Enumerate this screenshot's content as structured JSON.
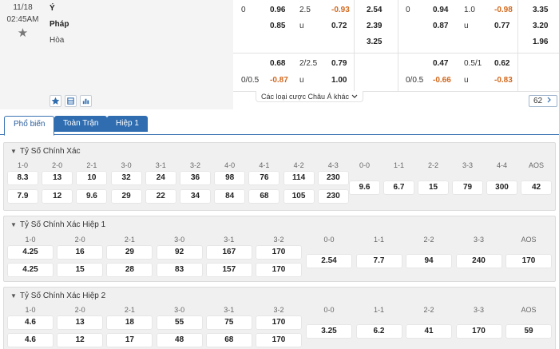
{
  "match": {
    "date": "11/18",
    "time": "02:45AM",
    "home": "Ý",
    "away": "Pháp",
    "draw": "Hòa",
    "more_bets_label": "Các loại cược Châu Á khác",
    "bet_count": "62",
    "odds": {
      "full": {
        "hdp_line": "0",
        "hdp_home": "0.96",
        "hdp_away": "0.85",
        "ou_line": "2.5",
        "ou_over": "-0.93",
        "ou_under_label": "u",
        "ou_under": "0.72",
        "x12_home": "2.54",
        "x12_away": "2.39",
        "x12_draw": "3.25"
      },
      "full_alt": {
        "hdp_line": "0/0.5",
        "hdp_home": "0.68",
        "hdp_away": "-0.87",
        "ou_line": "2/2.5",
        "ou_over": "0.79",
        "ou_under_label": "u",
        "ou_under": "1.00"
      },
      "half": {
        "hdp_line": "0",
        "hdp_home": "0.94",
        "hdp_away": "0.87",
        "ou_line": "1.0",
        "ou_over": "-0.98",
        "ou_under_label": "u",
        "ou_under": "0.77",
        "x12_home": "3.35",
        "x12_away": "3.20",
        "x12_draw": "1.96"
      },
      "half_alt": {
        "hdp_line": "0/0.5",
        "hdp_home": "0.47",
        "hdp_away": "-0.66",
        "ou_line": "0.5/1",
        "ou_over": "0.62",
        "ou_under_label": "u",
        "ou_under": "-0.83"
      }
    }
  },
  "tabs": [
    {
      "label": "Phổ biến",
      "state": "active"
    },
    {
      "label": "Toàn Trận",
      "state": "blue"
    },
    {
      "label": "Hiệp 1",
      "state": "blue"
    }
  ],
  "sections": [
    {
      "title": "Tỷ Số Chính Xác",
      "home_scores": [
        "1-0",
        "2-0",
        "2-1",
        "3-0",
        "3-1",
        "3-2",
        "4-0",
        "4-1",
        "4-2",
        "4-3"
      ],
      "home_odds": [
        "8.3",
        "13",
        "10",
        "32",
        "24",
        "36",
        "98",
        "76",
        "114",
        "230"
      ],
      "away_odds": [
        "7.9",
        "12",
        "9.6",
        "29",
        "22",
        "34",
        "84",
        "68",
        "105",
        "230"
      ],
      "draw_scores": [
        "0-0",
        "1-1",
        "2-2",
        "3-3",
        "4-4",
        "AOS"
      ],
      "draw_odds": [
        "9.6",
        "6.7",
        "15",
        "79",
        "300",
        "42"
      ]
    },
    {
      "title": "Tỷ Số Chính Xác Hiệp 1",
      "home_scores": [
        "1-0",
        "2-0",
        "2-1",
        "3-0",
        "3-1",
        "3-2"
      ],
      "home_odds": [
        "4.25",
        "16",
        "29",
        "92",
        "167",
        "170"
      ],
      "away_odds": [
        "4.25",
        "15",
        "28",
        "83",
        "157",
        "170"
      ],
      "draw_scores": [
        "0-0",
        "1-1",
        "2-2",
        "3-3",
        "AOS"
      ],
      "draw_odds": [
        "2.54",
        "7.7",
        "94",
        "240",
        "170"
      ]
    },
    {
      "title": "Tỷ Số Chính Xác Hiệp 2",
      "home_scores": [
        "1-0",
        "2-0",
        "2-1",
        "3-0",
        "3-1",
        "3-2"
      ],
      "home_odds": [
        "4.6",
        "13",
        "18",
        "55",
        "75",
        "170"
      ],
      "away_odds": [
        "4.6",
        "12",
        "17",
        "48",
        "68",
        "170"
      ],
      "draw_scores": [
        "0-0",
        "1-1",
        "2-2",
        "3-3",
        "AOS"
      ],
      "draw_odds": [
        "3.25",
        "6.2",
        "41",
        "170",
        "59"
      ]
    }
  ],
  "colors": {
    "negative_odds": "#d2691e",
    "tab_blue": "#2f6db0",
    "section_bg": "#f0f0f0"
  }
}
